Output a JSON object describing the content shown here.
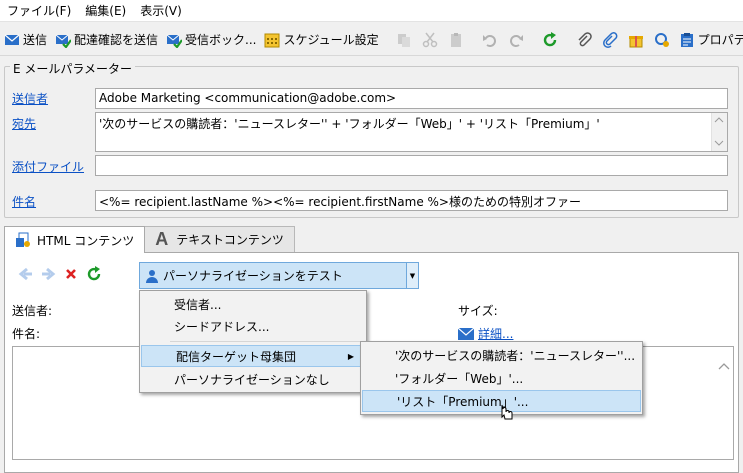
{
  "menubar": {
    "file": "ファイル(F)",
    "edit": "編集(E)",
    "view": "表示(V)"
  },
  "toolbar": {
    "send": "送信",
    "send_proof": "配達確認を送信",
    "inbox": "受信ボック...",
    "schedule": "スケジュール設定",
    "properties": "プロパティ"
  },
  "params": {
    "legend": "E メールパラメーター",
    "sender_label": "送信者",
    "sender_value": "Adobe Marketing  <communication@adobe.com>",
    "to_label": "宛先",
    "to_value": "'次のサービスの購読者：'ニュースレター'' + 'フォルダー「Web」' + 'リスト「Premium」'",
    "attach_label": "添付ファイル",
    "attach_value": "",
    "subject_label": "件名",
    "subject_value": "<%= recipient.lastName %><%= recipient.firstName %>様のための特別オファー"
  },
  "tabs": {
    "html": "HTML コンテンツ",
    "text": "テキストコンテンツ"
  },
  "preview": {
    "combo_label": "パーソナライゼーションをテスト",
    "sender_label": "送信者:",
    "subject_label": "件名:",
    "size_label": "サイズ:",
    "detail_link": "詳細..."
  },
  "menu": {
    "recipient": "受信者...",
    "seed": "シードアドレス...",
    "target": "配信ターゲット母集団",
    "none": "パーソナライゼーションなし"
  },
  "submenu": {
    "service": "'次のサービスの購読者：'ニュースレター''...",
    "folder": "'フォルダー「Web」'...",
    "list": "'リスト「Premium」'..."
  },
  "colors": {
    "accent": "#cce4f7",
    "link": "#0b51c5"
  }
}
